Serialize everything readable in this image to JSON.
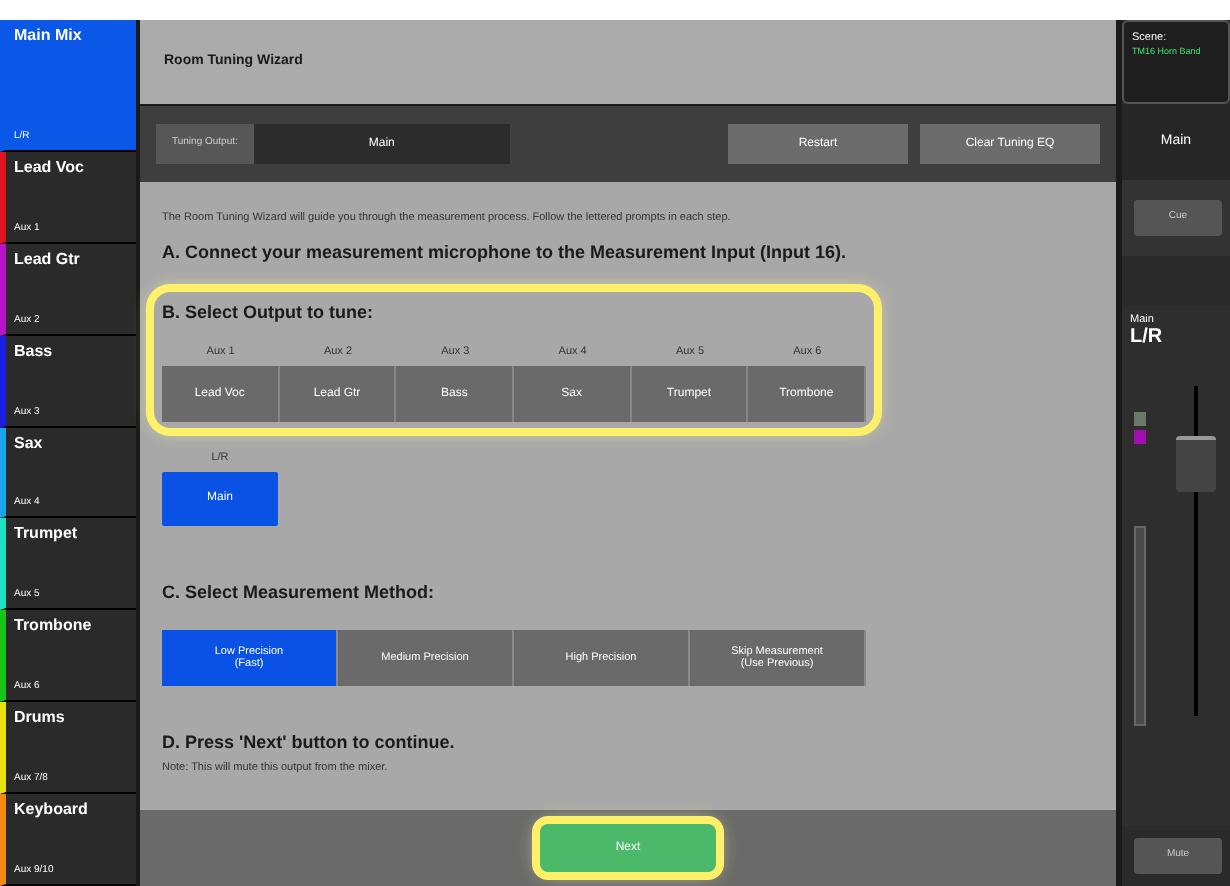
{
  "sidebar": {
    "items": [
      {
        "name": "Main Mix",
        "sub": "L/R",
        "color": "#0b57e8",
        "selected": true
      },
      {
        "name": "Lead Voc",
        "sub": "Aux 1",
        "color": "#e0141e",
        "selected": false
      },
      {
        "name": "Lead Gtr",
        "sub": "Aux 2",
        "color": "#b514c8",
        "selected": false
      },
      {
        "name": "Bass",
        "sub": "Aux 3",
        "color": "#1a1ee0",
        "selected": false
      },
      {
        "name": "Sax",
        "sub": "Aux 4",
        "color": "#1aa6e8",
        "selected": false
      },
      {
        "name": "Trumpet",
        "sub": "Aux 5",
        "color": "#1ee0c0",
        "selected": false
      },
      {
        "name": "Trombone",
        "sub": "Aux 6",
        "color": "#18c418",
        "selected": false
      },
      {
        "name": "Drums",
        "sub": "Aux 7/8",
        "color": "#e8e010",
        "selected": false
      },
      {
        "name": "Keyboard",
        "sub": "Aux 9/10",
        "color": "#f08a10",
        "selected": false
      }
    ]
  },
  "header": {
    "title": "Room Tuning Wizard"
  },
  "toolbar": {
    "label": "Tuning Output:",
    "value": "Main",
    "buttons": [
      "Restart",
      "Clear Tuning EQ"
    ]
  },
  "intro": "The Room Tuning Wizard will guide you through the measurement process. Follow the lettered prompts in each step.",
  "step_a": {
    "title": "A. Connect your measurement microphone to the Measurement Input (Input 16)."
  },
  "step_b": {
    "title": "B. Select Output to tune:",
    "highlighted": true,
    "outputs": [
      {
        "aux": "Aux 1",
        "name": "Lead Voc",
        "selected": false
      },
      {
        "aux": "Aux 2",
        "name": "Lead Gtr",
        "selected": false
      },
      {
        "aux": "Aux 3",
        "name": "Bass",
        "selected": false
      },
      {
        "aux": "Aux 4",
        "name": "Sax",
        "selected": false
      },
      {
        "aux": "Aux 5",
        "name": "Trumpet",
        "selected": false
      },
      {
        "aux": "Aux 6",
        "name": "Trombone",
        "selected": false
      }
    ],
    "main": {
      "aux": "L/R",
      "name": "Main",
      "selected": true
    }
  },
  "step_c": {
    "title": "C. Select Measurement Method:",
    "methods": [
      {
        "label": "Low Precision\n(Fast)",
        "selected": true
      },
      {
        "label": "Medium Precision",
        "selected": false
      },
      {
        "label": "High Precision",
        "selected": false
      },
      {
        "label": "Skip Measurement\n(Use Previous)",
        "selected": false
      }
    ]
  },
  "step_d": {
    "title": "D. Press 'Next' button to continue.",
    "note": "Note: This will mute this output from the mixer."
  },
  "next_button": {
    "label": "Next",
    "highlighted": true
  },
  "right_panel": {
    "scene_label": "Scene:",
    "scene_name": "TM16 Horn Band",
    "channel": "Main",
    "cue": "Cue",
    "strip_label": "Main",
    "strip_name": "L/R",
    "mute": "Mute"
  }
}
